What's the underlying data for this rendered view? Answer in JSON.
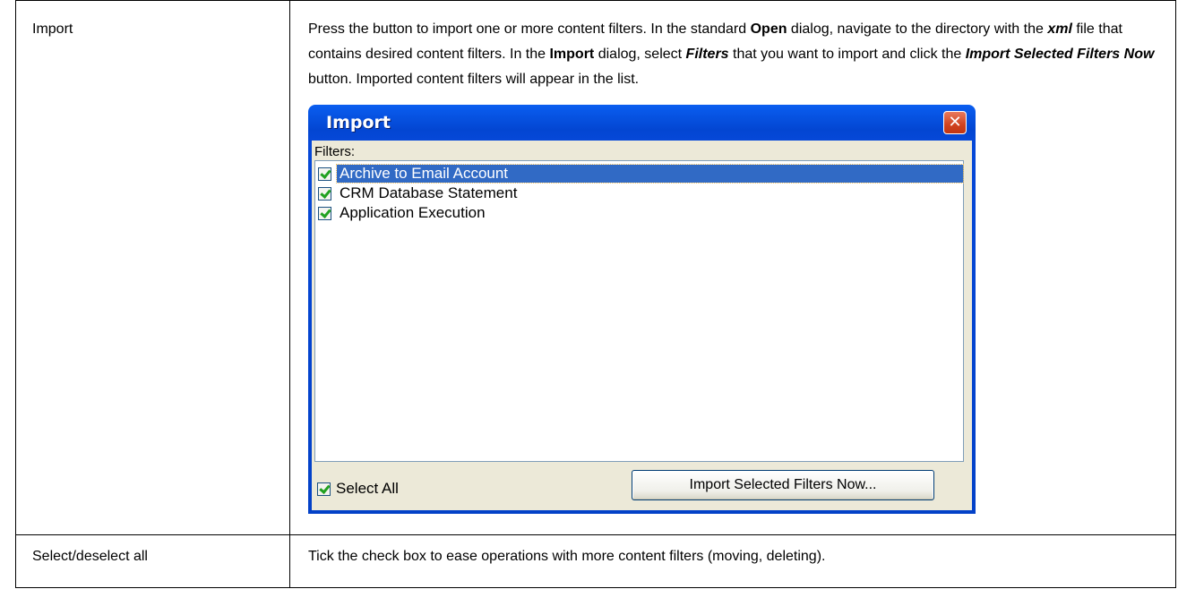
{
  "rows": [
    {
      "term": "Import",
      "desc": {
        "t1": "Press the button to import one or more content filters. In the standard ",
        "b1": "Open",
        "t2": " dialog, navigate to the directory with the ",
        "bi1": "xml",
        "t3": " file that contains desired content filters. In the ",
        "b2": "Import",
        "t4": " dialog, select ",
        "bi2": "Filters",
        "t5": " that you want to import and click the ",
        "bi3": "Import Selected Filters Now",
        "t6": " button. Imported content filters will appear in the list."
      }
    },
    {
      "term": "Select/deselect all",
      "desc": "Tick the check box to ease operations with more content filters (moving, deleting)."
    }
  ],
  "dialog": {
    "title": "Import",
    "close_glyph": "✕",
    "filters_label": "Filters:",
    "items": [
      {
        "label": "Archive to Email Account",
        "checked": true,
        "selected": true
      },
      {
        "label": "CRM Database Statement",
        "checked": true,
        "selected": false
      },
      {
        "label": "Application Execution",
        "checked": true,
        "selected": false
      }
    ],
    "select_all_label": "Select All",
    "import_button_label": "Import Selected Filters Now..."
  }
}
